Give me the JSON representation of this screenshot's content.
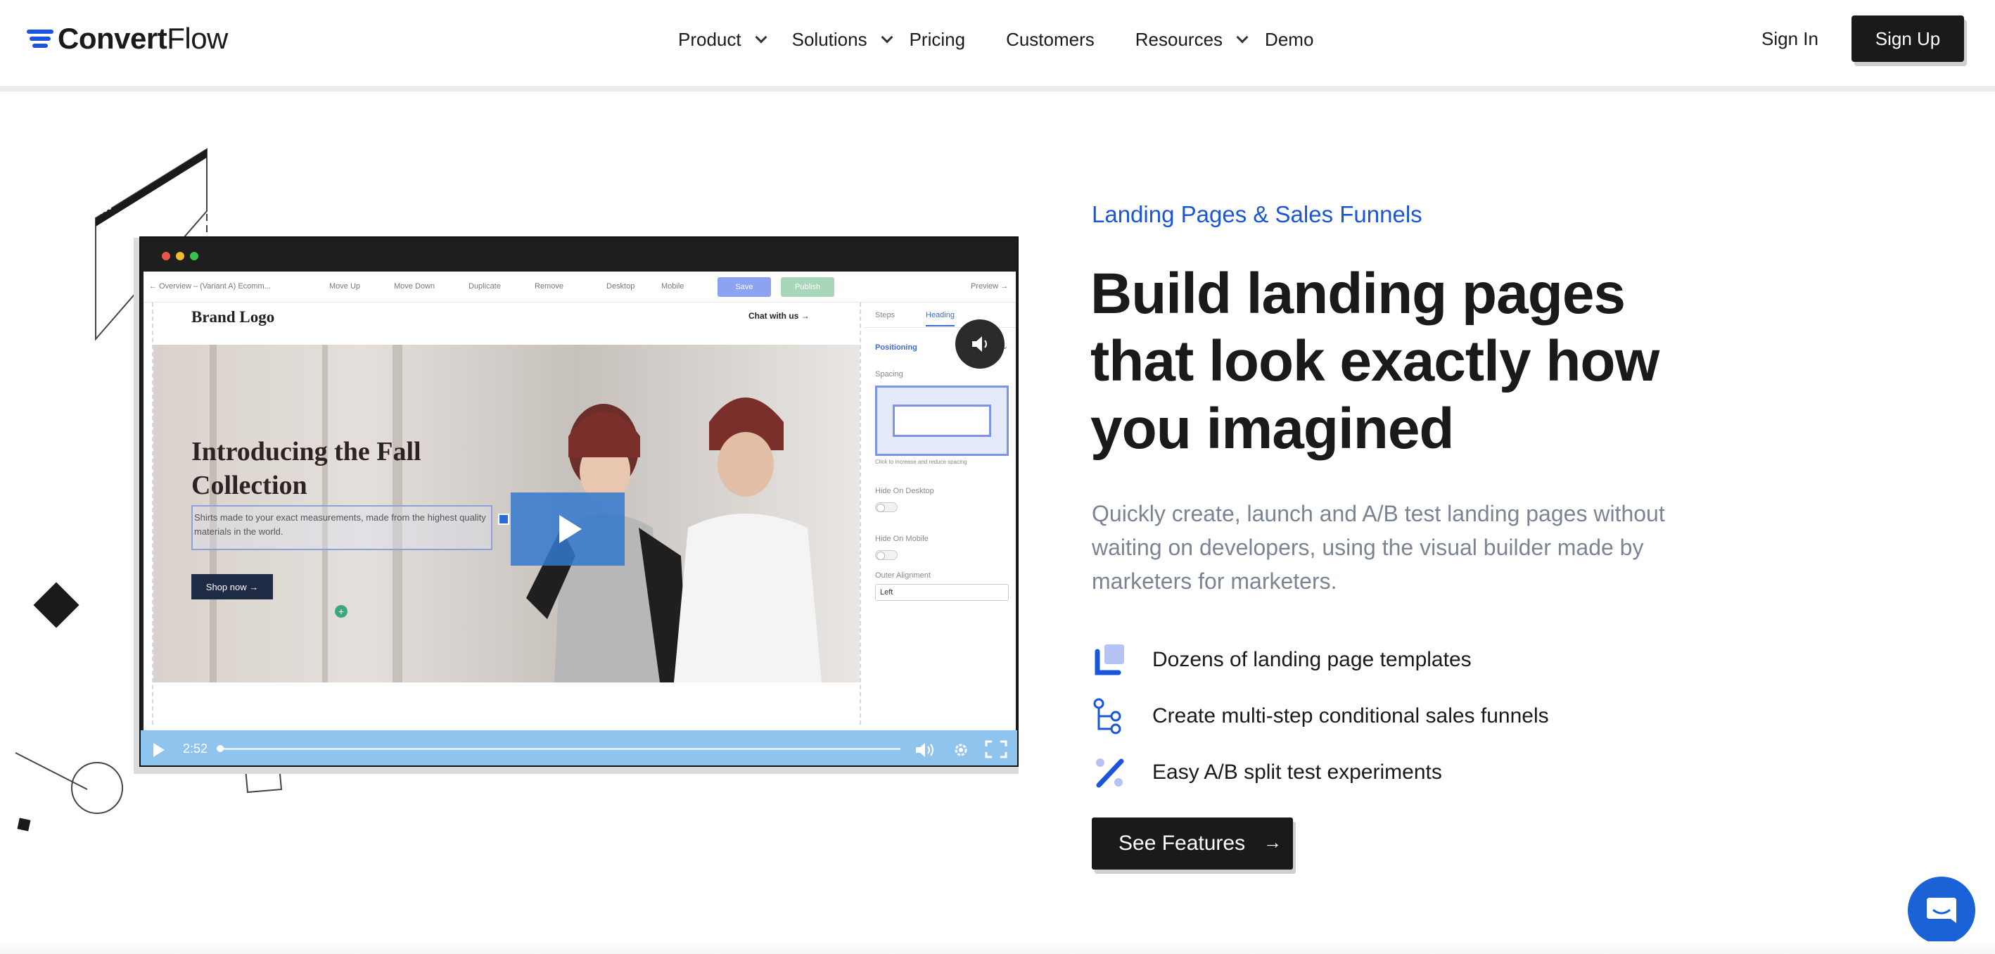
{
  "header": {
    "logo_text_bold": "Convert",
    "logo_text_light": "Flow",
    "nav": [
      {
        "label": "Product",
        "has_dropdown": true
      },
      {
        "label": "Solutions",
        "has_dropdown": true
      },
      {
        "label": "Pricing",
        "has_dropdown": false
      },
      {
        "label": "Customers",
        "has_dropdown": false
      },
      {
        "label": "Resources",
        "has_dropdown": true
      },
      {
        "label": "Demo",
        "has_dropdown": false
      }
    ],
    "sign_in": "Sign In",
    "sign_up": "Sign Up"
  },
  "video": {
    "toolbar": {
      "breadcrumb": "← Overview – (Variant A) Ecomm...",
      "move_up": "Move Up",
      "move_down": "Move Down",
      "duplicate": "Duplicate",
      "remove": "Remove",
      "desktop": "Desktop",
      "mobile": "Mobile",
      "save": "Save",
      "publish": "Publish",
      "preview": "Preview →"
    },
    "canvas": {
      "brand_logo": "Brand Logo",
      "chat_link": "Chat with us →",
      "title": "Introducing the Fall Collection",
      "body": "Shirts made to your exact measurements, made from the highest quality materials in the world.",
      "button": "Shop now →"
    },
    "panel": {
      "tab_steps": "Steps",
      "tab_heading": "Heading",
      "positioning": "Positioning",
      "spacing": "Spacing",
      "spacing_hint": "Click to increase and reduce spacing",
      "hide_desktop": "Hide On Desktop",
      "hide_mobile": "Hide On Mobile",
      "outer_alignment": "Outer Alignment",
      "alignment_value": "Left"
    },
    "controls": {
      "time": "2:52"
    }
  },
  "content": {
    "eyebrow": "Landing Pages & Sales Funnels",
    "headline": "Build landing pages that look exactly how you imagined",
    "subtext": "Quickly create, launch and A/B test landing pages without waiting on developers, using the visual builder made by marketers for marketers.",
    "features": [
      {
        "icon": "templates-icon",
        "label": "Dozens of landing page templates"
      },
      {
        "icon": "funnel-icon",
        "label": "Create multi-step conditional sales funnels"
      },
      {
        "icon": "split-test-icon",
        "label": "Easy A/B split test experiments"
      }
    ],
    "cta": "See Features",
    "cta_arrow": "→"
  },
  "colors": {
    "brand_blue": "#1a56db",
    "dark": "#1a1a1a",
    "muted_text": "#7a8494",
    "video_controls": "#8fc4ee"
  }
}
